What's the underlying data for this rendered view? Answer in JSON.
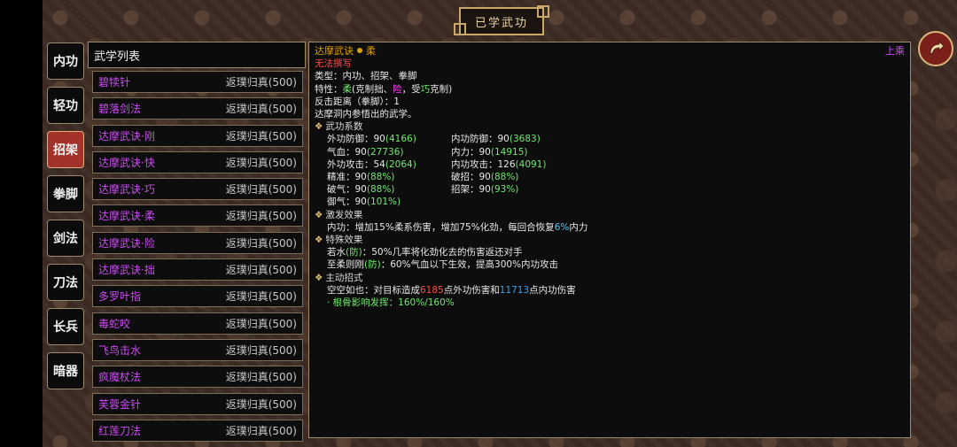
{
  "title": "已学武功",
  "tabs": [
    {
      "label": "内功",
      "active": false
    },
    {
      "label": "轻功",
      "active": false
    },
    {
      "label": "招架",
      "active": true
    },
    {
      "label": "拳脚",
      "active": false
    },
    {
      "label": "剑法",
      "active": false
    },
    {
      "label": "刀法",
      "active": false
    },
    {
      "label": "长兵",
      "active": false
    },
    {
      "label": "暗器",
      "active": false
    }
  ],
  "list": {
    "header": "武学列表",
    "items": [
      {
        "name": "碧犊针",
        "status": "返璞归真(500)"
      },
      {
        "name": "碧落剑法",
        "status": "返璞归真(500)"
      },
      {
        "name": "达摩武诀·刚",
        "status": "返璞归真(500)"
      },
      {
        "name": "达摩武诀·快",
        "status": "返璞归真(500)"
      },
      {
        "name": "达摩武诀·巧",
        "status": "返璞归真(500)"
      },
      {
        "name": "达摩武诀·柔",
        "status": "返璞归真(500)"
      },
      {
        "name": "达摩武诀·险",
        "status": "返璞归真(500)"
      },
      {
        "name": "达摩武诀·拙",
        "status": "返璞归真(500)"
      },
      {
        "name": "多罗叶指",
        "status": "返璞归真(500)"
      },
      {
        "name": "毒蛇咬",
        "status": "返璞归真(500)"
      },
      {
        "name": "飞鸟击水",
        "status": "返璞归真(500)"
      },
      {
        "name": "疯魔杖法",
        "status": "返璞归真(500)"
      },
      {
        "name": "芙蓉金针",
        "status": "返璞归真(500)"
      },
      {
        "name": "红莲刀法",
        "status": "返璞归真(500)"
      }
    ]
  },
  "detail": {
    "name_left": "达摩武诀",
    "name_right": "柔",
    "equip": "上乘",
    "cannot_write": "无法撰写",
    "type": "类型：内功、招架、拳脚",
    "trait_prefix": "特性：",
    "trait_rou": "柔",
    "trait_mid": "(克制拙、",
    "trait_xian": "险",
    "trait_mid2": "，受",
    "trait_qiao": "巧",
    "trait_end": "克制)",
    "range": "反击距离（拳脚）：1",
    "desc": "达摩洞内参悟出的武学。",
    "coef_title": "武功系数",
    "coefs": [
      {
        "label": "外功防御：90",
        "extra": "(4166)"
      },
      {
        "label": "内功防御：90",
        "extra": "(3683)"
      },
      {
        "label": "气血：90",
        "extra": "(27736)"
      },
      {
        "label": "内力：90",
        "extra": "(14915)"
      },
      {
        "label": "外功攻击：54",
        "extra": "(2064)"
      },
      {
        "label": "内功攻击：126",
        "extra": "(4091)"
      },
      {
        "label": "精准：90",
        "extra": "(88%)"
      },
      {
        "label": "破招：90",
        "extra": "(88%)"
      },
      {
        "label": "破气：90",
        "extra": "(88%)"
      },
      {
        "label": "招架：90",
        "extra": "(93%)"
      },
      {
        "label": "御气：90",
        "extra": "(101%)"
      }
    ],
    "trigger_title": "激发效果",
    "trigger_text": "内功：增加15%柔系伤害，增加75%化劲，每回合恢复",
    "trigger_pct": "6%",
    "trigger_end": "内力",
    "special_title": "特殊效果",
    "special1_name": "若水",
    "special1_tag": "(防)",
    "special1_text": "：50%几率将化劲化去的伤害返还对手",
    "special2_name": "至柔则刚",
    "special2_tag": "(防)",
    "special2_text": "：60%气血以下生效，提高300%内功攻击",
    "active_title": "主动招式",
    "active_text1": "空空如也：对目标造成",
    "active_num1": "6185",
    "active_text2": "点外功伤害和",
    "active_num2": "11713",
    "active_text3": "点内功伤害",
    "bone": "· 根骨影响发挥：160%/160%"
  }
}
